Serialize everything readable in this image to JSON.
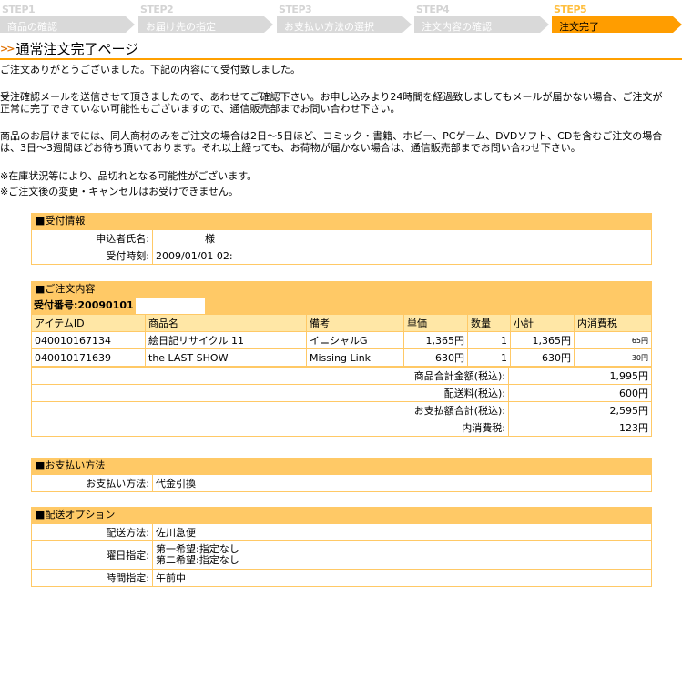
{
  "steps": [
    {
      "num": "STEP1",
      "label": "商品の確認"
    },
    {
      "num": "STEP2",
      "label": "お届け先の指定"
    },
    {
      "num": "STEP3",
      "label": "お支払い方法の選択"
    },
    {
      "num": "STEP4",
      "label": "注文内容の確認"
    },
    {
      "num": "STEP5",
      "label": "注文完了"
    }
  ],
  "page_title": "通常注文完了ページ",
  "messages": {
    "m1": "ご注文ありがとうございました。下記の内容にて受付致しました。",
    "m2": "受注確認メールを送信させて頂きましたので、あわせてご確認下さい。お申し込みより24時間を経過致しましてもメールが届かない場合、ご注文が正常に完了できていない可能性もございますので、通信販売部までお問い合わせ下さい。",
    "m3": "商品のお届けまでには、同人商材のみをご注文の場合は2日～5日ほど、コミック・書籍、ホビー、PCゲーム、DVDソフト、CDを含むご注文の場合は、3日～3週間ほどお待ち頂いております。それ以上経っても、お荷物が届かない場合は、通信販売部までお問い合わせ下さい。",
    "m4": "※在庫状況等により、品切れとなる可能性がございます。",
    "m5": "※ご注文後の変更・キャンセルはお受けできません。"
  },
  "reception": {
    "header": "■受付情報",
    "name_label": "申込者氏名:",
    "name_suffix": "様",
    "time_label": "受付時刻:",
    "time_value": "2009/01/01 02:"
  },
  "order": {
    "header": "■ご注文内容",
    "receipt_label": "受付番号:20090101",
    "columns": [
      "アイテムID",
      "商品名",
      "備考",
      "単価",
      "数量",
      "小計",
      "内消費税"
    ],
    "items": [
      {
        "id": "040010167134",
        "name": "絵日記リサイクル 11",
        "note": "イニシャルG",
        "price": "1,365円",
        "qty": "1",
        "subtotal": "1,365円",
        "tax": "65円"
      },
      {
        "id": "040010171639",
        "name": "the LAST SHOW",
        "note": "Missing Link",
        "price": "630円",
        "qty": "1",
        "subtotal": "630円",
        "tax": "30円"
      }
    ],
    "totals": [
      {
        "label": "商品合計金額(税込):",
        "value": "1,995円"
      },
      {
        "label": "配送料(税込):",
        "value": "600円"
      },
      {
        "label": "お支払額合計(税込):",
        "value": "2,595円"
      },
      {
        "label": "内消費税:",
        "value": "123円"
      }
    ]
  },
  "payment": {
    "header": "■お支払い方法",
    "label": "お支払い方法:",
    "value": "代金引換"
  },
  "delivery": {
    "header": "■配送オプション",
    "method_label": "配送方法:",
    "method_value": "佐川急便",
    "day_label": "曜日指定:",
    "day_value1": "第一希望:指定なし",
    "day_value2": "第二希望:指定なし",
    "time_label": "時間指定:",
    "time_value": "午前中"
  },
  "colors": {
    "accent": "#ff9d00",
    "panel": "#ffc966",
    "step_inactive": "#d9d9d9"
  }
}
